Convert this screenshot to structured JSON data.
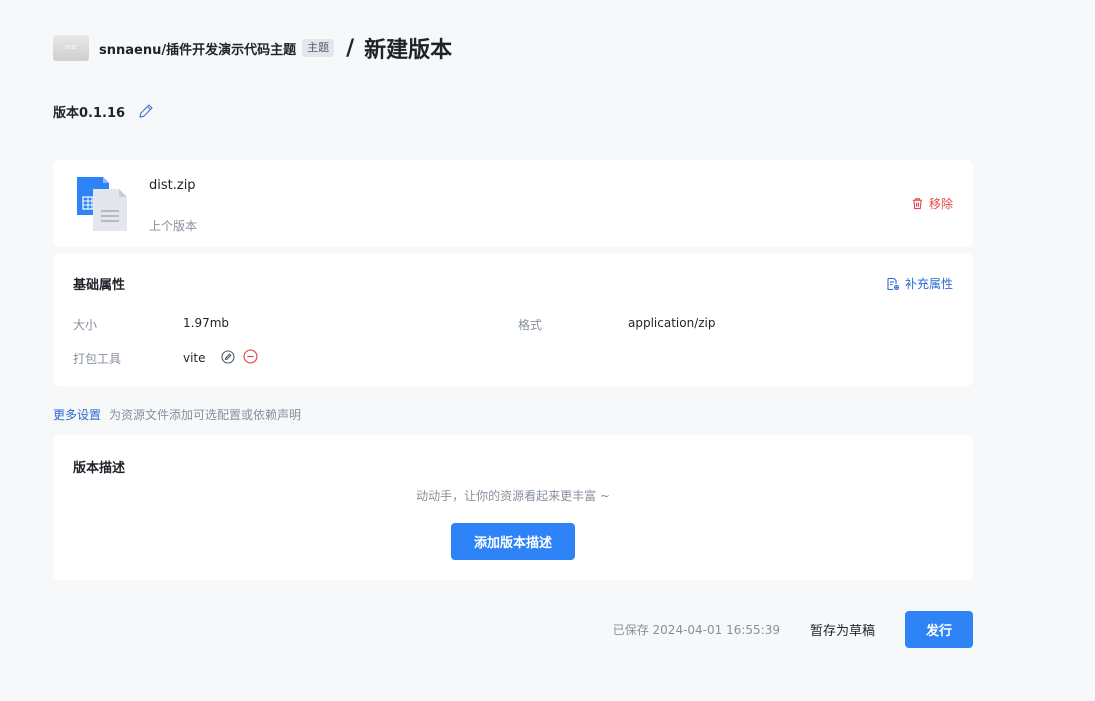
{
  "header": {
    "avatar_text": "DUE",
    "repo_name": "snnaenu/插件开发演示代码主题",
    "tag": "主题",
    "separator": "/",
    "page_title": "新建版本"
  },
  "version": {
    "label": "版本0.1.16"
  },
  "file": {
    "name": "dist.zip",
    "sub_label": "上个版本",
    "remove_label": "移除"
  },
  "attributes": {
    "title": "基础属性",
    "supplement_label": "补充属性",
    "size_label": "大小",
    "size_value": "1.97mb",
    "format_label": "格式",
    "format_value": "application/zip",
    "tool_label": "打包工具",
    "tool_value": "vite"
  },
  "more": {
    "link_label": "更多设置",
    "hint": "为资源文件添加可选配置或依赖声明"
  },
  "description": {
    "title": "版本描述",
    "empty_text": "动动手，让你的资源看起来更丰富 ~",
    "add_button_label": "添加版本描述"
  },
  "footer": {
    "saved_text": "已保存 2024-04-01 16:55:39",
    "draft_label": "暂存为草稿",
    "publish_label": "发行"
  },
  "colors": {
    "primary": "#2e83f6",
    "link": "#2e6ad1",
    "danger": "#e5484d",
    "background": "#f7f8fa"
  }
}
